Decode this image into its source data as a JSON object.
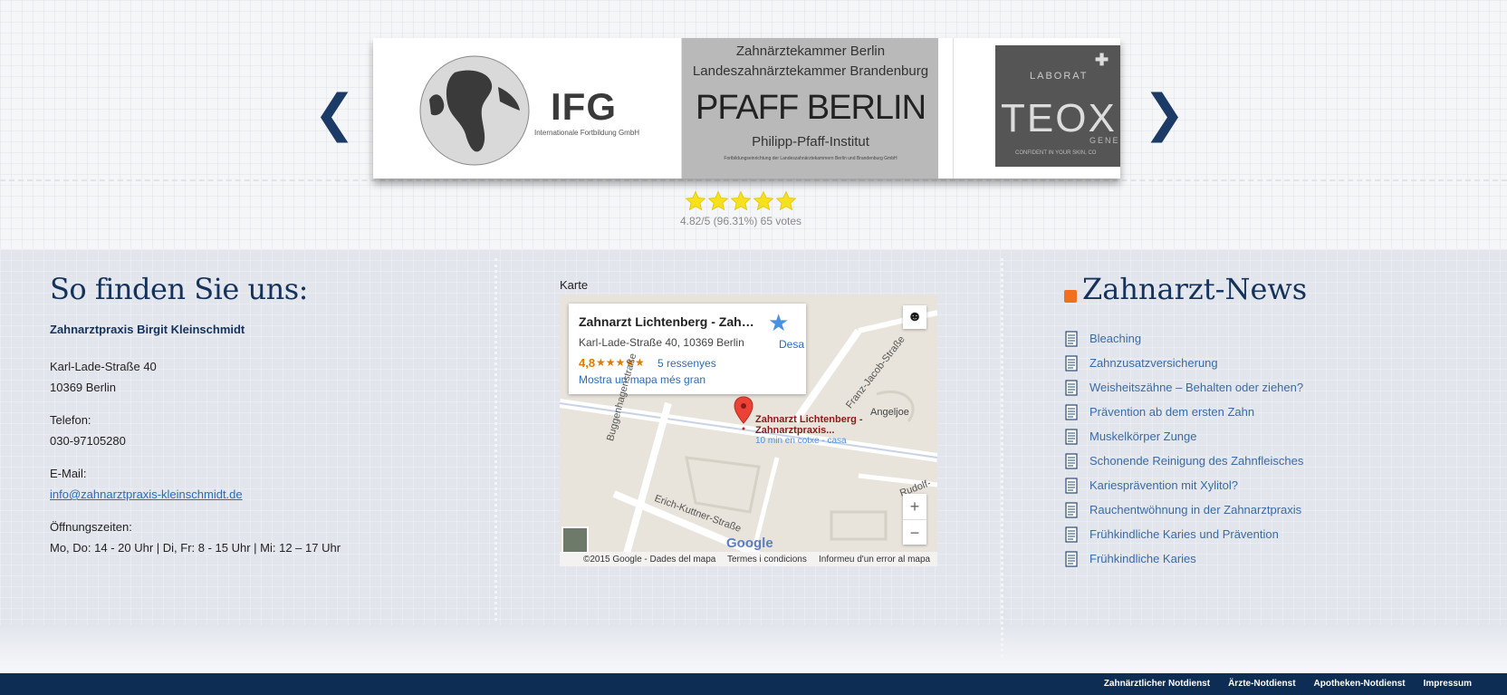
{
  "carousel": {
    "prev_label": "❮",
    "next_label": "❯",
    "slides": [
      {
        "logo_text": "IFG",
        "logo_subtitle": "Internationale Fortbildung GmbH"
      },
      {
        "line1": "Zahnärztekammer Berlin",
        "line2": "Landeszahnärztekammer Brandenburg",
        "main": "PFAFF BERLIN",
        "line3": "Philipp-Pfaff-Institut",
        "line4": "Fortbildungseinrichtung der Landeszahnärztekammern Berlin und Brandenburg GmbH"
      },
      {
        "label": "LABORAT",
        "name": "TEOX",
        "gen": "GENE",
        "tagline": "CONFIDENT IN YOUR SKIN, CO"
      }
    ]
  },
  "rating": {
    "stars": 5,
    "text": "4.82/5 (96.31%) 65 votes",
    "star_color": "#f7e01c"
  },
  "contact": {
    "title": "So finden Sie uns:",
    "practice": "Zahnarztpraxis Birgit Kleinschmidt",
    "street": "Karl-Lade-Straße 40",
    "city": "10369 Berlin",
    "phone_label": "Telefon:",
    "phone": "030-97105280",
    "email_label": "E-Mail:",
    "email": "info@zahnarztpraxis-kleinschmidt.de",
    "hours_label": "Öffnungszeiten:",
    "hours": "Mo, Do: 14 - 20 Uhr | Di, Fr: 8 - 15 Uhr | Mi: 12 – 17 Uhr"
  },
  "map": {
    "label": "Karte",
    "card_title": "Zahnarzt Lichtenberg - Zahna...",
    "card_address": "Karl-Lade-Straße 40, 10369 Berlin",
    "card_score": "4,8",
    "card_stars": "★★★★★",
    "card_reviews": "5 ressenyes",
    "card_bigger_map": "Mostra un mapa més gran",
    "card_save": "Desa",
    "pin_label": "Zahnarzt Lichtenberg - Zahnarztpraxis...",
    "pin_sub": "10 min en cotxe - casa",
    "streets": [
      "Franz-Jacob-Straße",
      "Buggenhagenstraße",
      "Erich-Kuttner-Straße",
      "Rudolf-"
    ],
    "poi": "Angeljoe",
    "zoom_in": "+",
    "zoom_out": "−",
    "google": "Google",
    "footer_copyright": "©2015 Google - Dades del mapa",
    "footer_terms": "Termes i condicions",
    "footer_report": "Informeu d'un error al mapa"
  },
  "news": {
    "title": "Zahnarzt-News",
    "items": [
      "Bleaching",
      "Zahnzusatzversicherung",
      "Weisheitszähne – Behalten oder ziehen?",
      "Prävention ab dem ersten Zahn",
      "Muskelkörper Zunge",
      "Schonende Reinigung des Zahnfleisches",
      "Kariesprävention mit Xylitol?",
      "Rauchentwöhnung in der Zahnarztpraxis",
      "Frühkindliche Karies und Prävention",
      "Frühkindliche Karies"
    ]
  },
  "footer": {
    "links": [
      "Zahnärztlicher Notdienst",
      "Ärzte-Notdienst",
      "Apotheken-Notdienst",
      "Impressum"
    ]
  },
  "colors": {
    "brand_navy": "#14325c",
    "footer_bg": "#0d2d55",
    "link_blue": "#3b6aa3",
    "rss_orange": "#f26f21"
  }
}
